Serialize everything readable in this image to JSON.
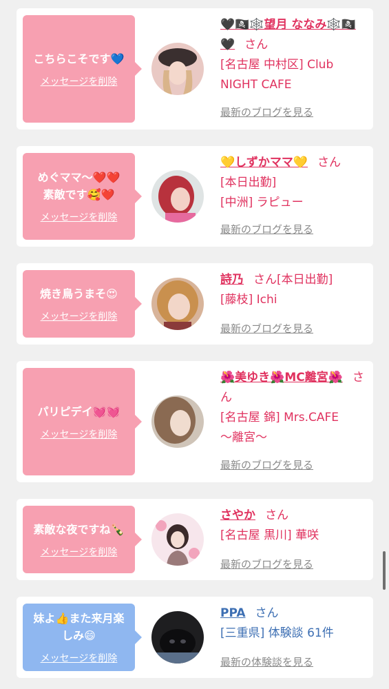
{
  "delete_label": "メッセージを削除",
  "san": "さん",
  "cards": [
    {
      "message": "こちらこそです💙",
      "name": "🖤🏴‍☠️🕸️望月 ななみ🕸️🏴‍☠️🖤",
      "lines": "[名古屋 中村区] Club\nNIGHT CAFE",
      "link": "最新のブログを見る"
    },
    {
      "message": "めぐママ〜❤️❤️\n素敵です🥰❤️",
      "name": "💛しずかママ💛",
      "lines": "[本日出勤]\n[中洲] ラピュー",
      "link": "最新のブログを見る"
    },
    {
      "message": "焼き鳥うまそ😍",
      "name": "詩乃",
      "name_suffix": "[本日出勤]",
      "lines": "[藤枝] Ichi",
      "link": "最新のブログを見る"
    },
    {
      "message": "パリピデイ💓💓",
      "name": "🌺美ゆき🌺MC離宮🌺",
      "lines": "[名古屋 錦] Mrs.CAFE\n〜離宮〜",
      "link": "最新のブログを見る"
    },
    {
      "message": "素敵な夜ですね🍾",
      "name": "さやか",
      "lines": "[名古屋 黒川] 華咲",
      "link": "最新のブログを見る"
    },
    {
      "message": "妹よ👍また来月楽\nしみ😄",
      "name": "PPA",
      "lines": "[三重県] 体験談 61件",
      "link": "最新の体験談を見る"
    }
  ],
  "colors": {
    "pink_bubble": "#f7a0b1",
    "blue_bubble": "#8fb7f0",
    "name_pink": "#e0325f",
    "name_blue": "#3d6fb3"
  },
  "icons": [
    "avatar-photo"
  ]
}
